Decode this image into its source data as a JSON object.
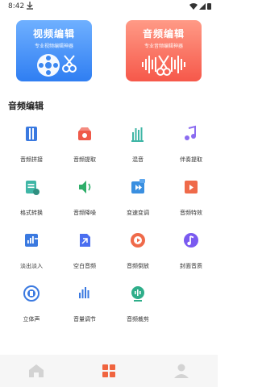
{
  "status": {
    "time": "8:42"
  },
  "cards": {
    "video": {
      "title": "视频编辑",
      "subtitle": "专业视频编辑神器"
    },
    "audio": {
      "title": "音频编辑",
      "subtitle": "专业音频编辑神器"
    }
  },
  "section": {
    "title": "音频编辑"
  },
  "tools": [
    {
      "label": "音频拼接",
      "icon": "audio-splice-icon",
      "color": "#3a79e0"
    },
    {
      "label": "音频提取",
      "icon": "audio-extract-icon",
      "color": "#ef5a4a"
    },
    {
      "label": "混音",
      "icon": "mix-icon",
      "color": "#3fb6a6"
    },
    {
      "label": "伴奏提取",
      "icon": "accompaniment-icon",
      "color": "#8b6cf0"
    },
    {
      "label": "格式转换",
      "icon": "format-convert-icon",
      "color": "#3fb6a6"
    },
    {
      "label": "音频降噪",
      "icon": "noise-reduction-icon",
      "color": "#2fae6a"
    },
    {
      "label": "变速变调",
      "icon": "speed-pitch-icon",
      "color": "#3a8fe0"
    },
    {
      "label": "音频特效",
      "icon": "audio-effect-icon",
      "color": "#ef6a4a"
    },
    {
      "label": "淡出淡入",
      "icon": "fade-icon",
      "color": "#3a79e0"
    },
    {
      "label": "空白音频",
      "icon": "blank-audio-icon",
      "color": "#4a6ef0"
    },
    {
      "label": "音频倒放",
      "icon": "reverse-icon",
      "color": "#ef6a4a"
    },
    {
      "label": "封面音质",
      "icon": "cover-quality-icon",
      "color": "#7a5af0"
    },
    {
      "label": "立体声",
      "icon": "stereo-icon",
      "color": "#3a79e0"
    },
    {
      "label": "音量调节",
      "icon": "volume-icon",
      "color": "#3a79e0"
    },
    {
      "label": "音频裁剪",
      "icon": "audio-trim-icon",
      "color": "#2fae8a"
    }
  ],
  "tabs": [
    {
      "name": "home-tab-icon",
      "active": false
    },
    {
      "name": "tools-tab-icon",
      "active": true,
      "color": "#f0643f"
    },
    {
      "name": "profile-tab-icon",
      "active": false
    }
  ]
}
